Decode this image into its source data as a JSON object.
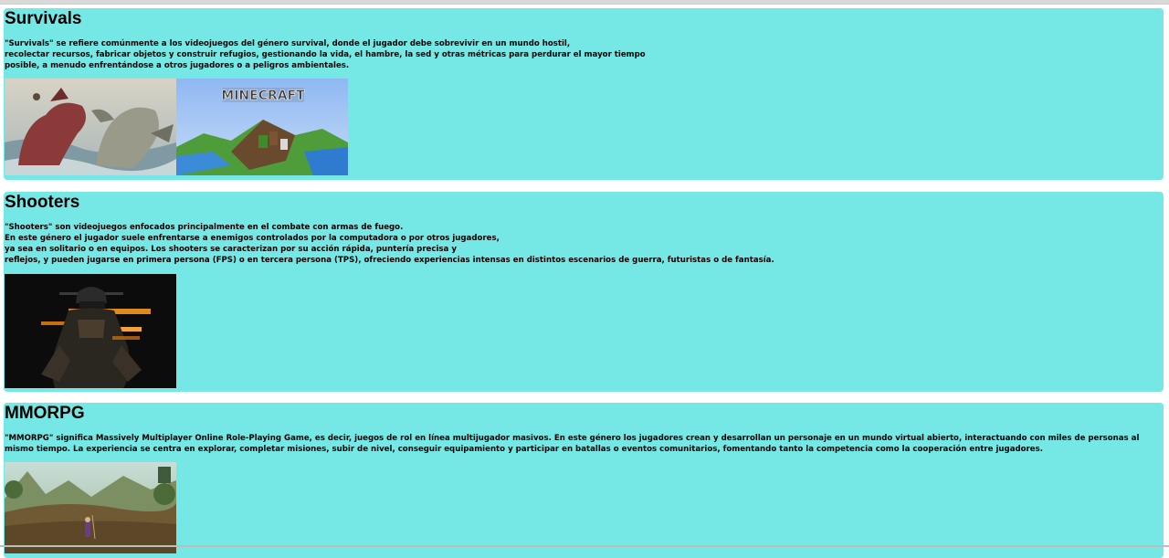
{
  "sections": [
    {
      "title": "Survivals",
      "description": "\"Survivals\" se refiere comúnmente a los videojuegos del género survival, donde el jugador debe sobrevivir en un mundo hostil,\nrecolectar recursos, fabricar objetos y construir refugios, gestionando la vida, el hambre, la sed y otras métricas para perdurar el mayor tiempo\nposible, a menudo enfrentándose a otros jugadores o a peligros ambientales.",
      "images": [
        {
          "alt": "dinosaur-battle-image"
        },
        {
          "alt": "minecraft-cover-image",
          "logo_text": "MINECRAFT"
        }
      ]
    },
    {
      "title": "Shooters",
      "description": "\"Shooters\" son videojuegos enfocados principalmente en el combate con armas de fuego.\nEn este género el jugador suele enfrentarse a enemigos controlados por la computadora o por otros jugadores,\nya sea en solitario o en equipos. Los shooters se caracterizan por su acción rápida, puntería precisa y\nreflejos, y pueden jugarse en primera persona (FPS) o en tercera persona (TPS), ofreciendo experiencias intensas en distintos escenarios de guerra, futuristas o de fantasía.",
      "images": [
        {
          "alt": "soldier-image"
        }
      ]
    },
    {
      "title": "MMORPG",
      "description": "\"MMORPG\" significa Massively Multiplayer Online Role-Playing Game, es decir, juegos de rol en línea multijugador masivos. En este género los jugadores crean y desarrollan un personaje en un mundo virtual abierto, interactuando con miles de personas al mismo tiempo. La experiencia se centra en explorar, completar misiones, subir de nivel, conseguir equipamiento y participar en batallas o eventos comunitarios, fomentando tanto la competencia como la cooperación entre jugadores.",
      "images": [
        {
          "alt": "fantasy-landscape-image"
        }
      ]
    }
  ],
  "colors": {
    "section_bg": "#75e8e6",
    "text": "#000000"
  }
}
